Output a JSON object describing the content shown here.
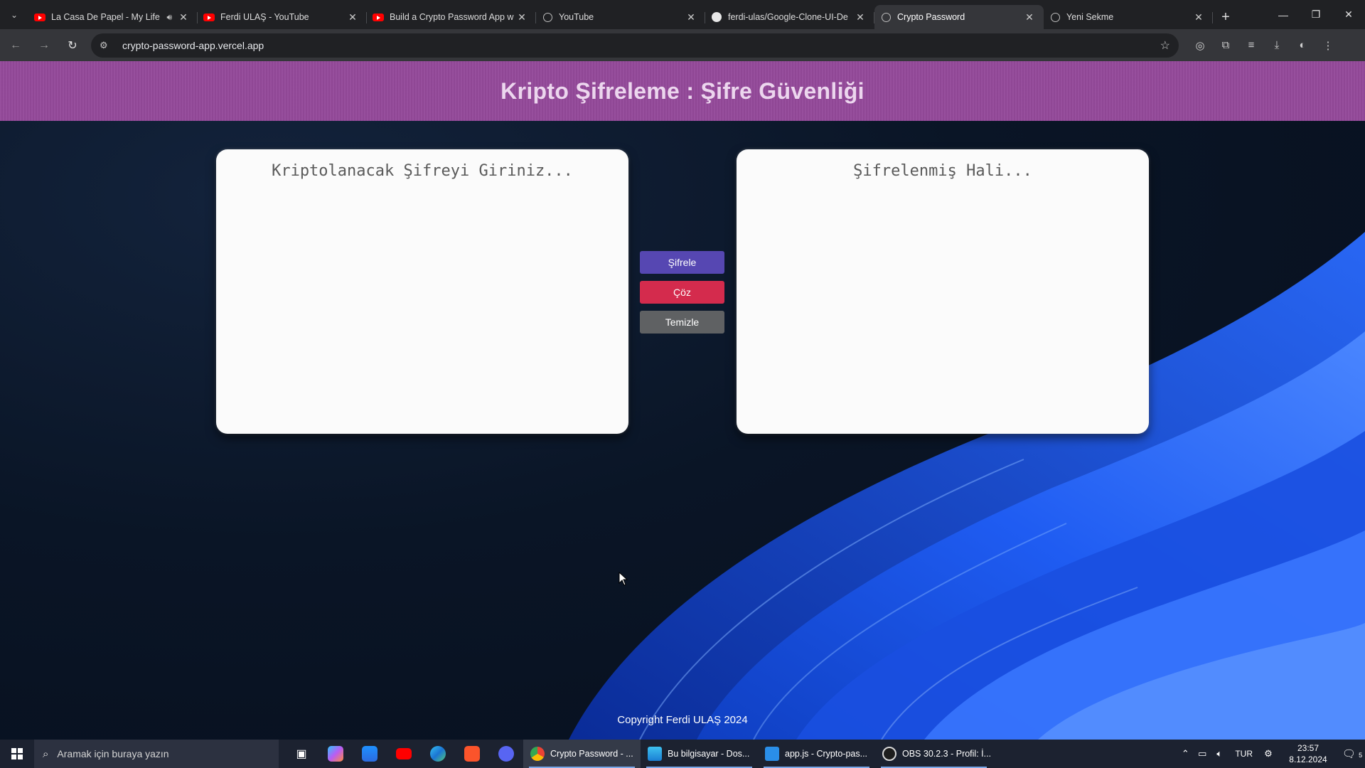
{
  "browser": {
    "tabs": [
      {
        "title": "La Casa De Papel - My Life",
        "icon": "youtube-icon",
        "audio": true
      },
      {
        "title": "Ferdi ULAŞ - YouTube",
        "icon": "youtube-icon"
      },
      {
        "title": "Build a Crypto Password App w",
        "icon": "youtube-icon"
      },
      {
        "title": "YouTube",
        "icon": "globe-icon"
      },
      {
        "title": "ferdi-ulas/Google-Clone-UI-De",
        "icon": "github-icon"
      },
      {
        "title": "Crypto Password",
        "icon": "globe-icon",
        "active": true
      },
      {
        "title": "Yeni Sekme",
        "icon": "globe-icon"
      }
    ],
    "url": "crypto-password-app.vercel.app"
  },
  "page": {
    "title": "Kripto Şifreleme : Şifre Güvenliği",
    "input_placeholder": "Kriptolanacak Şifreyi Giriniz...",
    "output_placeholder": "Şifrelenmiş Hali...",
    "buttons": {
      "encrypt": "Şifrele",
      "decrypt": "Çöz",
      "clear": "Temizle"
    },
    "footer": "Copyright Ferdi ULAŞ 2024",
    "colors": {
      "header": "#94499a",
      "encrypt": "#5647b2",
      "decrypt": "#d42b4d",
      "clear": "#5f6163"
    }
  },
  "taskbar": {
    "search_placeholder": "Aramak için buraya yazın",
    "tasks": [
      {
        "label": "Crypto Password - ...",
        "icon": "chrome-icon",
        "active": true
      },
      {
        "label": "Bu bilgisayar - Dos...",
        "icon": "file-explorer-icon"
      },
      {
        "label": "app.js - Crypto-pas...",
        "icon": "vscode-icon"
      },
      {
        "label": "OBS 30.2.3 - Profil: İ...",
        "icon": "obs-icon"
      }
    ],
    "language": "TUR",
    "time": "23:57",
    "date": "8.12.2024",
    "notification_count": "5"
  }
}
